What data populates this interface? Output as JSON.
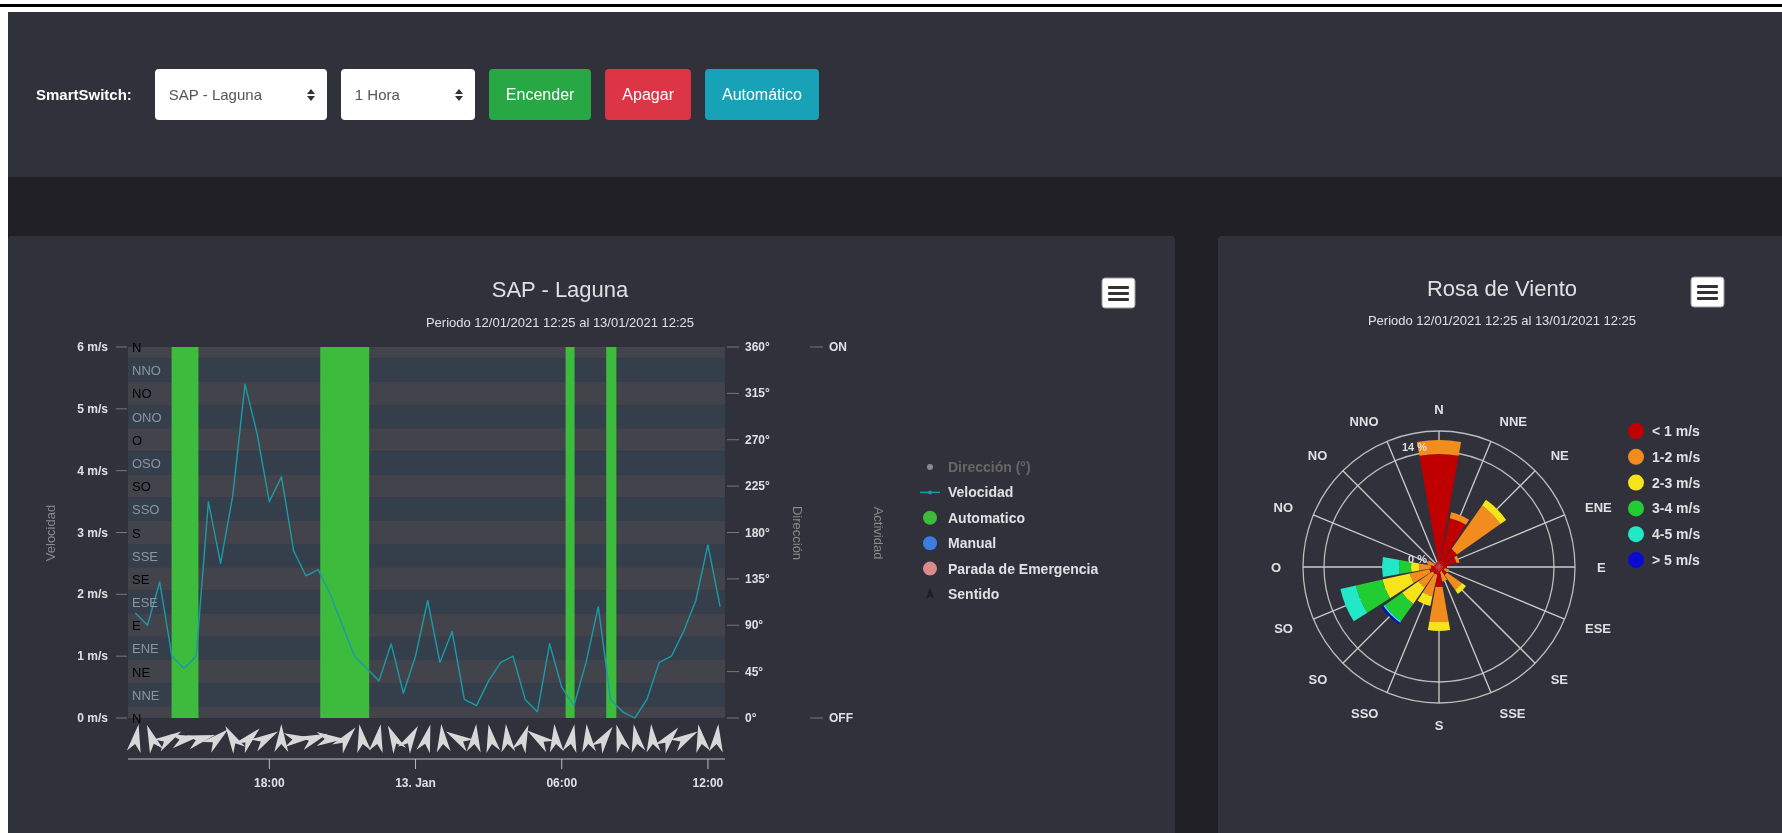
{
  "header": {
    "label": "SmartSwitch:",
    "selects": [
      {
        "value": "SAP - Laguna"
      },
      {
        "value": "1 Hora"
      }
    ],
    "buttons": [
      {
        "label": "Encender",
        "kind": "success"
      },
      {
        "label": "Apagar",
        "kind": "danger"
      },
      {
        "label": "Automático",
        "kind": "info"
      }
    ]
  },
  "speed_panel": {
    "title": "SAP - Laguna",
    "subtitle": "Periodo 12/01/2021 12:25 al 13/01/2021 12:25",
    "chart_data": {
      "type": "line",
      "ylabel": "Velocidad",
      "xlim": [
        "2021-01-12T12:12",
        "2021-01-13T12:42"
      ],
      "ylim": [
        0,
        6
      ],
      "x": [
        "2021-01-12T12:30",
        "2021-01-12T13:00",
        "2021-01-12T13:30",
        "2021-01-12T14:00",
        "2021-01-12T14:30",
        "2021-01-12T15:00",
        "2021-01-12T15:30",
        "2021-01-12T16:00",
        "2021-01-12T16:30",
        "2021-01-12T17:00",
        "2021-01-12T17:30",
        "2021-01-12T18:00",
        "2021-01-12T18:30",
        "2021-01-12T19:00",
        "2021-01-12T19:30",
        "2021-01-12T20:00",
        "2021-01-12T20:30",
        "2021-01-12T21:00",
        "2021-01-12T21:30",
        "2021-01-12T22:00",
        "2021-01-12T22:30",
        "2021-01-12T23:00",
        "2021-01-12T23:30",
        "2021-01-13T00:00",
        "2021-01-13T00:30",
        "2021-01-13T01:00",
        "2021-01-13T01:30",
        "2021-01-13T02:00",
        "2021-01-13T02:30",
        "2021-01-13T03:00",
        "2021-01-13T03:30",
        "2021-01-13T04:00",
        "2021-01-13T04:30",
        "2021-01-13T05:00",
        "2021-01-13T05:30",
        "2021-01-13T06:00",
        "2021-01-13T06:30",
        "2021-01-13T07:00",
        "2021-01-13T07:30",
        "2021-01-13T08:00",
        "2021-01-13T08:30",
        "2021-01-13T09:00",
        "2021-01-13T09:30",
        "2021-01-13T10:00",
        "2021-01-13T10:30",
        "2021-01-13T11:00",
        "2021-01-13T11:30",
        "2021-01-13T12:00",
        "2021-01-13T12:30"
      ],
      "xticks": [
        {
          "value": "2021-01-12T18:00",
          "label": "18:00"
        },
        {
          "value": "2021-01-13T00:00",
          "label": "13. Jan"
        },
        {
          "value": "2021-01-13T06:00",
          "label": "06:00"
        },
        {
          "value": "2021-01-13T12:00",
          "label": "12:00"
        }
      ],
      "yticks": [
        {
          "value": 0,
          "label": "0 m/s"
        },
        {
          "value": 1,
          "label": "1 m/s"
        },
        {
          "value": 2,
          "label": "2 m/s"
        },
        {
          "value": 3,
          "label": "3 m/s"
        },
        {
          "value": 4,
          "label": "4 m/s"
        },
        {
          "value": 5,
          "label": "5 m/s"
        },
        {
          "value": 6,
          "label": "6 m/s"
        }
      ],
      "series": [
        {
          "name": "Velocidad",
          "color": "#1a9ba8",
          "values": [
            1.7,
            1.5,
            2.2,
            1.0,
            0.8,
            1.0,
            3.5,
            2.5,
            3.6,
            5.4,
            4.6,
            3.5,
            3.9,
            2.7,
            2.3,
            2.4,
            2.0,
            1.5,
            1.0,
            0.8,
            0.6,
            1.2,
            0.4,
            1.0,
            1.9,
            0.9,
            1.4,
            0.3,
            0.2,
            0.6,
            0.9,
            1.0,
            0.3,
            0.1,
            1.2,
            0.5,
            0.2,
            0.9,
            1.8,
            0.3,
            0.1,
            0.0,
            0.3,
            0.9,
            1.0,
            1.4,
            1.9,
            2.8,
            1.8
          ]
        }
      ]
    },
    "legend": [
      {
        "label": "Dirección (°)",
        "kind": "dot",
        "color": "#8a8a8a",
        "disabled": true
      },
      {
        "kind": "line",
        "disabled": false
      },
      {
        "label": "Automatico",
        "kind": "circle",
        "color": "#3dbb3d",
        "disabled": false
      },
      {
        "label": "Manual",
        "kind": "circle",
        "color": "#3a7ee0",
        "disabled": false
      },
      {
        "label": "Parada de Emergencia",
        "kind": "circle",
        "color": "#d98b8b",
        "disabled": false
      },
      {
        "label": "Sentido",
        "kind": "arrow",
        "color": "#1e1e24",
        "disabled": false
      }
    ],
    "direction_bands": [
      "N",
      "NNO",
      "NO",
      "ONO",
      "O",
      "OSO",
      "SO",
      "SSO",
      "S",
      "SSE",
      "SE",
      "ESE",
      "E",
      "ENE",
      "NE",
      "NNE",
      "N"
    ],
    "direction_axis": {
      "title": "Dirección",
      "ticks": [
        "360°",
        "315°",
        "270°",
        "225°",
        "180°",
        "135°",
        "90°",
        "45°",
        "0°"
      ]
    },
    "activity_axis": {
      "title": "Actividad",
      "ticks": [
        "ON",
        "OFF"
      ]
    }
  },
  "wind_rose": {
    "title": "Rosa de Viento",
    "subtitle": "Periodo 12/01/2021 12:25 al 13/01/2021 12:25",
    "directions": {
      "right": [
        "N",
        "NNE",
        "NE",
        "ENE",
        "E",
        "ESE",
        "SE",
        "SSE",
        "S"
      ],
      "left": [
        "NNO",
        "NO",
        "NO",
        "O",
        "SO",
        "SO",
        "SSO"
      ]
    },
    "scale_labels": [
      "14 %",
      "0 %"
    ],
    "legend": [
      {
        "label": "< 1 m/s",
        "color": "#c00000"
      },
      {
        "label": "1-2 m/s",
        "color": "#f28c1e"
      },
      {
        "label": "2-3 m/s",
        "color": "#f5e31b"
      },
      {
        "label": "3-4 m/s",
        "color": "#22cc33"
      },
      {
        "label": "4-5 m/s",
        "color": "#22e8c8"
      },
      {
        "label": "> 5 m/s",
        "color": "#0a0ad0"
      }
    ]
  }
}
